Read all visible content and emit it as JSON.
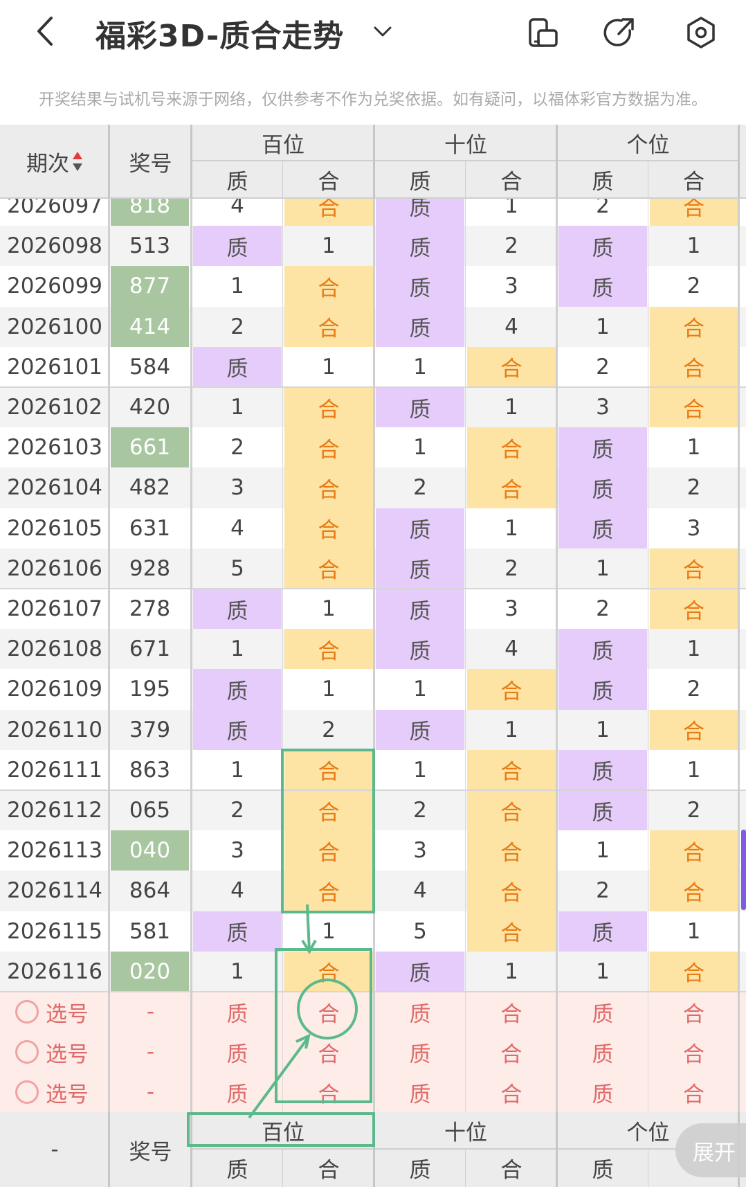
{
  "header": {
    "title": "福彩3D-质合走势",
    "notice": "开奖结果与试机号来源于网络，仅供参考不作为兑奖依据。如有疑问，以福体彩官方数据为准。"
  },
  "columns": {
    "period": "期次",
    "number": "奖号",
    "groups": [
      "百位",
      "十位",
      "个位"
    ],
    "sub": [
      "质",
      "合"
    ]
  },
  "rows": [
    {
      "period": "2026097",
      "number": "818",
      "green": true,
      "cells": [
        "4",
        "合",
        "质",
        "1",
        "2",
        "合"
      ]
    },
    {
      "period": "2026098",
      "number": "513",
      "green": false,
      "cells": [
        "质",
        "1",
        "质",
        "2",
        "质",
        "1"
      ]
    },
    {
      "period": "2026099",
      "number": "877",
      "green": true,
      "cells": [
        "1",
        "合",
        "质",
        "3",
        "质",
        "2"
      ]
    },
    {
      "period": "2026100",
      "number": "414",
      "green": true,
      "cells": [
        "2",
        "合",
        "质",
        "4",
        "1",
        "合"
      ]
    },
    {
      "period": "2026101",
      "number": "584",
      "green": false,
      "cells": [
        "质",
        "1",
        "1",
        "合",
        "2",
        "合"
      ]
    },
    {
      "period": "2026102",
      "number": "420",
      "green": false,
      "cells": [
        "1",
        "合",
        "质",
        "1",
        "3",
        "合"
      ]
    },
    {
      "period": "2026103",
      "number": "661",
      "green": true,
      "cells": [
        "2",
        "合",
        "1",
        "合",
        "质",
        "1"
      ]
    },
    {
      "period": "2026104",
      "number": "482",
      "green": false,
      "cells": [
        "3",
        "合",
        "2",
        "合",
        "质",
        "2"
      ]
    },
    {
      "period": "2026105",
      "number": "631",
      "green": false,
      "cells": [
        "4",
        "合",
        "质",
        "1",
        "质",
        "3"
      ]
    },
    {
      "period": "2026106",
      "number": "928",
      "green": false,
      "cells": [
        "5",
        "合",
        "质",
        "2",
        "1",
        "合"
      ]
    },
    {
      "period": "2026107",
      "number": "278",
      "green": false,
      "cells": [
        "质",
        "1",
        "质",
        "3",
        "2",
        "合"
      ]
    },
    {
      "period": "2026108",
      "number": "671",
      "green": false,
      "cells": [
        "1",
        "合",
        "质",
        "4",
        "质",
        "1"
      ]
    },
    {
      "period": "2026109",
      "number": "195",
      "green": false,
      "cells": [
        "质",
        "1",
        "1",
        "合",
        "质",
        "2"
      ]
    },
    {
      "period": "2026110",
      "number": "379",
      "green": false,
      "cells": [
        "质",
        "2",
        "质",
        "1",
        "1",
        "合"
      ]
    },
    {
      "period": "2026111",
      "number": "863",
      "green": false,
      "cells": [
        "1",
        "合",
        "1",
        "合",
        "质",
        "1"
      ]
    },
    {
      "period": "2026112",
      "number": "065",
      "green": false,
      "cells": [
        "2",
        "合",
        "2",
        "合",
        "质",
        "2"
      ]
    },
    {
      "period": "2026113",
      "number": "040",
      "green": true,
      "cells": [
        "3",
        "合",
        "3",
        "合",
        "1",
        "合"
      ]
    },
    {
      "period": "2026114",
      "number": "864",
      "green": false,
      "cells": [
        "4",
        "合",
        "4",
        "合",
        "2",
        "合"
      ]
    },
    {
      "period": "2026115",
      "number": "581",
      "green": false,
      "cells": [
        "质",
        "1",
        "5",
        "合",
        "质",
        "1"
      ]
    },
    {
      "period": "2026116",
      "number": "020",
      "green": true,
      "cells": [
        "1",
        "合",
        "质",
        "1",
        "1",
        "合"
      ]
    }
  ],
  "pick_rows": [
    {
      "label": "选号",
      "number": "-",
      "cells": [
        "质",
        "合",
        "质",
        "合",
        "质",
        "合"
      ]
    },
    {
      "label": "选号",
      "number": "-",
      "cells": [
        "质",
        "合",
        "质",
        "合",
        "质",
        "合"
      ]
    },
    {
      "label": "选号",
      "number": "-",
      "cells": [
        "质",
        "合",
        "质",
        "合",
        "质",
        "合"
      ]
    }
  ],
  "footer": {
    "period": "-",
    "number": "奖号",
    "groups": [
      "百位",
      "十位",
      "个位"
    ],
    "sub": [
      "质",
      "合",
      "质",
      "合",
      "质"
    ]
  },
  "expand_label": "展开",
  "colors": {
    "zhi": "#e6ccfa",
    "he": "#fde3a4",
    "he_text": "#e87b14",
    "green_number": "#a8c6a0",
    "annotation": "#5bb98b",
    "pick_bg": "#fdece8"
  }
}
